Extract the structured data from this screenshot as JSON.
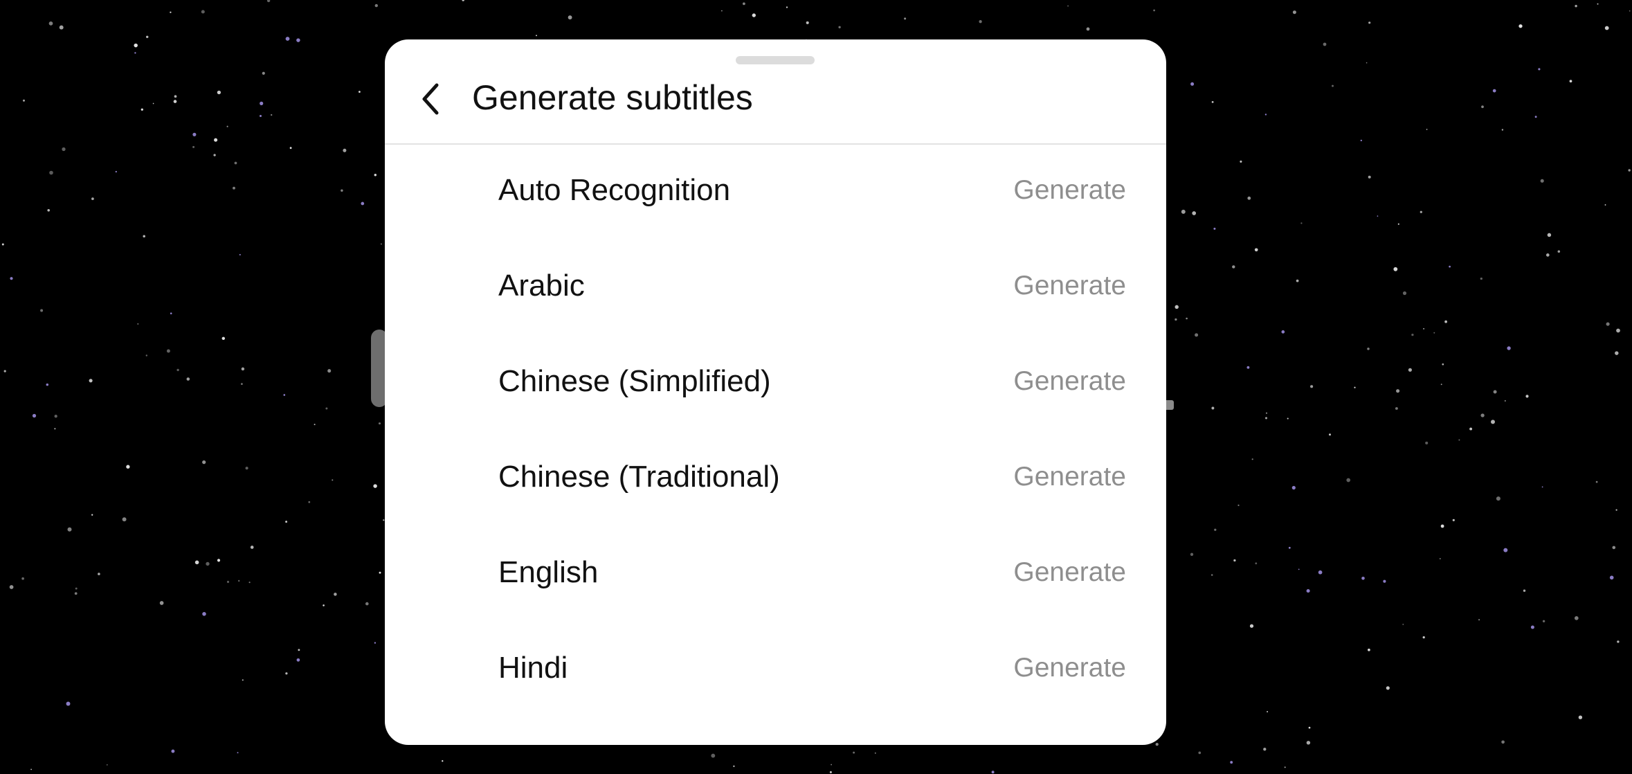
{
  "sheet": {
    "title": "Generate subtitles",
    "back_icon": "chevron-left-icon"
  },
  "languages": [
    {
      "label": "Auto Recognition",
      "action": "Generate"
    },
    {
      "label": "Arabic",
      "action": "Generate"
    },
    {
      "label": "Chinese (Simplified)",
      "action": "Generate"
    },
    {
      "label": "Chinese (Traditional)",
      "action": "Generate"
    },
    {
      "label": "English",
      "action": "Generate"
    },
    {
      "label": "Hindi",
      "action": "Generate"
    }
  ],
  "colors": {
    "background": "#000000",
    "sheet": "#ffffff",
    "text_primary": "#111111",
    "text_secondary": "#8e8e8e"
  }
}
